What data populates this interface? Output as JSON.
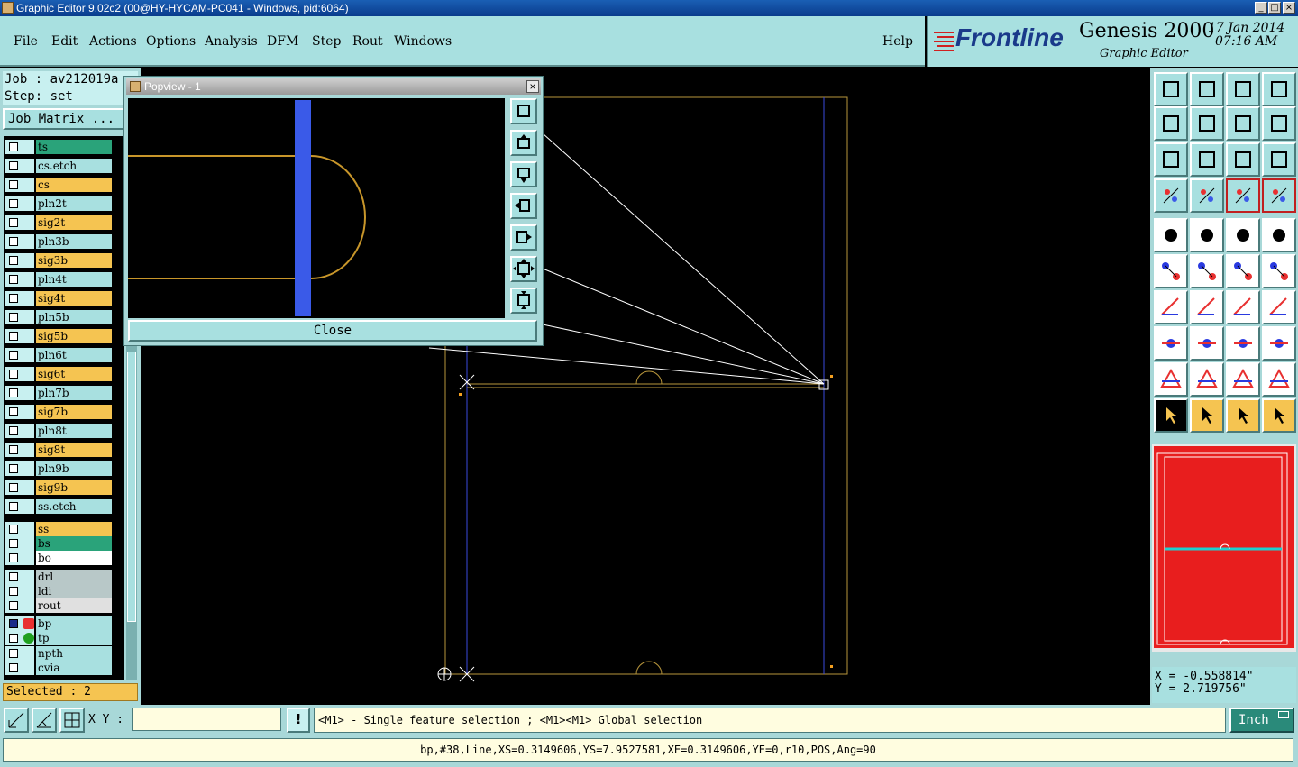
{
  "window": {
    "title": "Graphic Editor 9.02c2 (00@HY-HYCAM-PC041 - Windows, pid:6064)"
  },
  "menu": [
    {
      "key": "file",
      "label": "File"
    },
    {
      "key": "edit",
      "label": "Edit"
    },
    {
      "key": "actions",
      "label": "Actions"
    },
    {
      "key": "options",
      "label": "Options"
    },
    {
      "key": "analysis",
      "label": "Analysis"
    },
    {
      "key": "dfm",
      "label": "DFM"
    },
    {
      "key": "step",
      "label": "Step"
    },
    {
      "key": "rout",
      "label": "Rout"
    },
    {
      "key": "windows",
      "label": "Windows"
    }
  ],
  "help_label": "Help",
  "brand": {
    "logo": "Frontline",
    "product": "Genesis 2000",
    "subtitle": "Graphic Editor",
    "date": "17 Jan 2014",
    "time": "07:16 AM"
  },
  "job": {
    "job_line": "Job : av212019a",
    "step_line": "Step: set",
    "job_matrix_label": "Job Matrix ..."
  },
  "layers": [
    {
      "name": "ts",
      "color": "#2aa37a"
    },
    {
      "name": "cs.etch",
      "color": "#a8e0e0"
    },
    {
      "name": "cs",
      "color": "#f5c451"
    },
    {
      "name": "pln2t",
      "color": "#a8e0e0"
    },
    {
      "name": "sig2t",
      "color": "#f5c451"
    },
    {
      "name": "pln3b",
      "color": "#a8e0e0"
    },
    {
      "name": "sig3b",
      "color": "#f5c451"
    },
    {
      "name": "pln4t",
      "color": "#a8e0e0"
    },
    {
      "name": "sig4t",
      "color": "#f5c451"
    },
    {
      "name": "pln5b",
      "color": "#a8e0e0"
    },
    {
      "name": "sig5b",
      "color": "#f5c451"
    },
    {
      "name": "pln6t",
      "color": "#a8e0e0"
    },
    {
      "name": "sig6t",
      "color": "#f5c451"
    },
    {
      "name": "pln7b",
      "color": "#a8e0e0"
    },
    {
      "name": "sig7b",
      "color": "#f5c451"
    },
    {
      "name": "pln8t",
      "color": "#a8e0e0"
    },
    {
      "name": "sig8t",
      "color": "#f5c451"
    },
    {
      "name": "pln9b",
      "color": "#a8e0e0"
    },
    {
      "name": "sig9b",
      "color": "#f5c451"
    },
    {
      "name": "ss.etch",
      "color": "#a8e0e0"
    },
    {
      "name": "ss",
      "color": "#f5c451"
    },
    {
      "name": "bs",
      "color": "#2aa37a"
    },
    {
      "name": "bo",
      "color": "#ffffff"
    },
    {
      "name": "drl",
      "color": "#b8c8c8"
    },
    {
      "name": "ldi",
      "color": "#b8c8c8"
    },
    {
      "name": "rout",
      "color": "#e0e0e0"
    },
    {
      "name": "bp",
      "color": "#a8e0e0"
    },
    {
      "name": "tp",
      "color": "#a8e0e0"
    },
    {
      "name": "npth",
      "color": "#a8e0e0"
    },
    {
      "name": "cvia",
      "color": "#a8e0e0"
    }
  ],
  "selected_label": "Selected : 2",
  "popview": {
    "title": "Popview - 1",
    "close_label": "Close"
  },
  "coords": {
    "x": "X = -0.558814\"",
    "y": "Y = 2.719756\""
  },
  "bottom": {
    "xy_label": "X Y :",
    "xy_value": "",
    "bang_label": "!",
    "hint": "<M1> - Single feature selection ; <M1><M1> Global selection",
    "units": "Inch"
  },
  "status": "bp,#38,Line,XS=0.3149606,YS=7.9527581,XE=0.3149606,YE=0,r10,POS,Ang=90",
  "colors": {
    "accent": "#a8e0e0",
    "highlight": "#f5c451",
    "panel_red": "#e81e1e"
  }
}
